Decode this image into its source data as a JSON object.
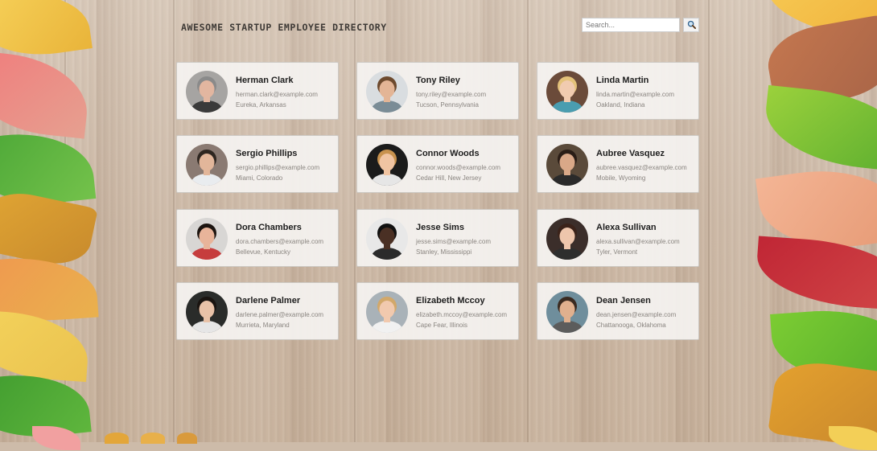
{
  "header": {
    "title": "AWESOME STARTUP EMPLOYEE DIRECTORY",
    "search_placeholder": "Search...",
    "search_icon": "magnifier-icon"
  },
  "employees": [
    {
      "name": "Herman Clark",
      "email": "herman.clark@example.com",
      "location": "Eureka, Arkansas",
      "bg": "#a6a4a2",
      "skin": "#e2b6a0",
      "hair": "#8a8a8a",
      "shirt": "#3a3a3a"
    },
    {
      "name": "Tony Riley",
      "email": "tony.riley@example.com",
      "location": "Tucson, Pennsylvania",
      "bg": "#d9dde0",
      "skin": "#e3b596",
      "hair": "#6d4a2e",
      "shirt": "#7a8c96"
    },
    {
      "name": "Linda Martin",
      "email": "linda.martin@example.com",
      "location": "Oakland, Indiana",
      "bg": "#6b4b3a",
      "skin": "#f1cbb0",
      "hair": "#e4c27a",
      "shirt": "#4a9db0"
    },
    {
      "name": "Sergio Phillips",
      "email": "sergio.phillips@example.com",
      "location": "Miami, Colorado",
      "bg": "#8a7a72",
      "skin": "#e2b69a",
      "hair": "#2e2620",
      "shirt": "#e9ecef"
    },
    {
      "name": "Connor Woods",
      "email": "connor.woods@example.com",
      "location": "Cedar Hill, New Jersey",
      "bg": "#1b1b1b",
      "skin": "#f0c4a2",
      "hair": "#c8924e",
      "shirt": "#e6e6e6"
    },
    {
      "name": "Aubree Vasquez",
      "email": "aubree.vasquez@example.com",
      "location": "Mobile, Wyoming",
      "bg": "#5a4a3a",
      "skin": "#d9a888",
      "hair": "#2a1d16",
      "shirt": "#2a2a2a"
    },
    {
      "name": "Dora Chambers",
      "email": "dora.chambers@example.com",
      "location": "Bellevue, Kentucky",
      "bg": "#d8d6d4",
      "skin": "#e8b49a",
      "hair": "#1c1410",
      "shirt": "#c63d3d"
    },
    {
      "name": "Jesse Sims",
      "email": "jesse.sims@example.com",
      "location": "Stanley, Mississippi",
      "bg": "#e8e8e8",
      "skin": "#4a3024",
      "hair": "#111111",
      "shirt": "#2b2b2b"
    },
    {
      "name": "Alexa Sullivan",
      "email": "alexa.sullivan@example.com",
      "location": "Tyler, Vermont",
      "bg": "#3b2e2a",
      "skin": "#eec6ac",
      "hair": "#3b231a",
      "shirt": "#2e2e2e"
    },
    {
      "name": "Darlene Palmer",
      "email": "darlene.palmer@example.com",
      "location": "Murrieta, Maryland",
      "bg": "#2a2c2a",
      "skin": "#e8c2a8",
      "hair": "#1a1410",
      "shirt": "#e6e6e6"
    },
    {
      "name": "Elizabeth Mccoy",
      "email": "elizabeth.mccoy@example.com",
      "location": "Cape Fear, Illinois",
      "bg": "#a9b2b8",
      "skin": "#f1c9ae",
      "hair": "#d2a86a",
      "shirt": "#f1f1f1"
    },
    {
      "name": "Dean Jensen",
      "email": "dean.jensen@example.com",
      "location": "Chattanooga, Oklahoma",
      "bg": "#6f8e9c",
      "skin": "#e0b08e",
      "hair": "#3a2a20",
      "shirt": "#5c5c5c"
    }
  ]
}
